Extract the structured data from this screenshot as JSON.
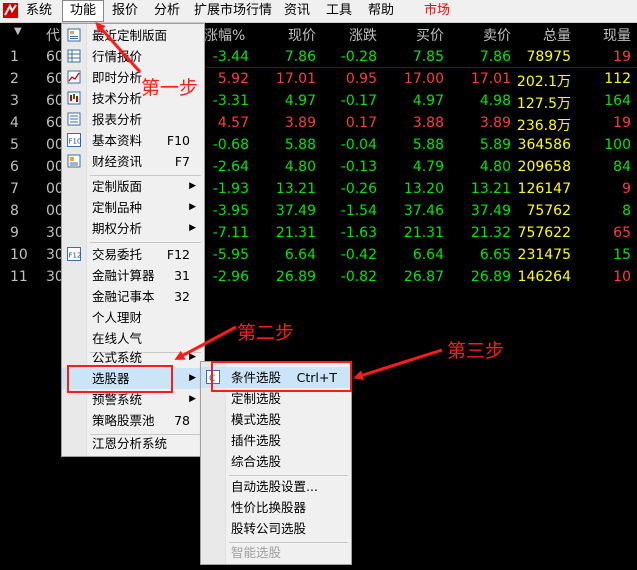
{
  "menubar": {
    "items": [
      "系统",
      "功能",
      "报价",
      "分析",
      "扩展市场行情",
      "资讯",
      "工具",
      "帮助"
    ],
    "market": "市场"
  },
  "columns": {
    "sort_icon": "triangle-down-icon",
    "code": "代",
    "change_pct": "涨幅%",
    "price": "现价",
    "change": "涨跌",
    "bid": "买价",
    "ask": "卖价",
    "volume": "总量",
    "current_volume": "现量"
  },
  "rows": [
    {
      "num": "1",
      "code": "60",
      "pct": "-3.44",
      "price": "7.86",
      "chg": "-0.28",
      "bid": "7.85",
      "ask": "7.86",
      "vol": "78975",
      "cur": "19"
    },
    {
      "num": "2",
      "code": "60",
      "pct": "5.92",
      "price": "17.01",
      "chg": "0.95",
      "bid": "17.00",
      "ask": "17.01",
      "vol": "202.1万",
      "cur": "112"
    },
    {
      "num": "3",
      "code": "60",
      "pct": "-3.31",
      "price": "4.97",
      "chg": "-0.17",
      "bid": "4.97",
      "ask": "4.98",
      "vol": "127.5万",
      "cur": "164"
    },
    {
      "num": "4",
      "code": "60",
      "pct": "4.57",
      "price": "3.89",
      "chg": "0.17",
      "bid": "3.88",
      "ask": "3.89",
      "vol": "236.8万",
      "cur": "19"
    },
    {
      "num": "5",
      "code": "00",
      "pct": "-0.68",
      "price": "5.88",
      "chg": "-0.04",
      "bid": "5.88",
      "ask": "5.89",
      "vol": "364586",
      "cur": "100"
    },
    {
      "num": "6",
      "code": "00",
      "pct": "-2.64",
      "price": "4.80",
      "chg": "-0.13",
      "bid": "4.79",
      "ask": "4.80",
      "vol": "209658",
      "cur": "84"
    },
    {
      "num": "7",
      "code": "00",
      "pct": "-1.93",
      "price": "13.21",
      "chg": "-0.26",
      "bid": "13.20",
      "ask": "13.21",
      "vol": "126147",
      "cur": "9"
    },
    {
      "num": "8",
      "code": "00",
      "pct": "-3.95",
      "price": "37.49",
      "chg": "-1.54",
      "bid": "37.46",
      "ask": "37.49",
      "vol": "75762",
      "cur": "8"
    },
    {
      "num": "9",
      "code": "30",
      "pct": "-7.11",
      "price": "21.31",
      "chg": "-1.63",
      "bid": "21.31",
      "ask": "21.32",
      "vol": "757622",
      "cur": "65"
    },
    {
      "num": "10",
      "code": "30",
      "pct": "-5.95",
      "price": "6.64",
      "chg": "-0.42",
      "bid": "6.64",
      "ask": "6.65",
      "vol": "231475",
      "cur": "15"
    },
    {
      "num": "11",
      "code": "30",
      "pct": "-2.96",
      "price": "26.89",
      "chg": "-0.82",
      "bid": "26.87",
      "ask": "26.89",
      "vol": "146264",
      "cur": "10"
    }
  ],
  "function_menu": {
    "custom_layout": "最近定制版面",
    "quote_report": "行情报价",
    "realtime_analysis": "即时分析",
    "technical_analysis": "技术分析",
    "report_analysis": "报表分析",
    "basic_info": "基本资料",
    "basic_info_key": "F10",
    "finance_news": "财经资讯",
    "finance_news_key": "F7",
    "custom_layout2": "定制版面",
    "custom_variety": "定制品种",
    "options_analysis": "期权分析",
    "trade_order": "交易委托",
    "trade_order_key": "F12",
    "calculator": "金融计算器",
    "calculator_key": "31",
    "notebook": "金融记事本",
    "notebook_key": "32",
    "personal_finance": "个人理财",
    "online_popularity": "在线人气",
    "formula_system": "公式系统",
    "stock_selector": "选股器",
    "alert_system": "预警系统",
    "strategy_pool": "策略股票池",
    "strategy_pool_key": "78",
    "jiangen": "江恩分析系统"
  },
  "submenu": {
    "condition": "条件选股",
    "condition_key": "Ctrl+T",
    "custom": "定制选股",
    "pattern": "模式选股",
    "plugin": "插件选股",
    "composite": "综合选股",
    "auto_settings": "自动选股设置...",
    "price_ratio": "性价比换股器",
    "transfer": "股转公司选股",
    "smart": "智能选股"
  },
  "annotations": {
    "step1": "第一步",
    "step2": "第二步",
    "step3": "第三步"
  },
  "colors": {
    "up": "#ff3b3b",
    "down": "#00e600",
    "volume": "#ffff00",
    "annotation": "#ff1a1a",
    "highlight": "#cce4f7"
  }
}
